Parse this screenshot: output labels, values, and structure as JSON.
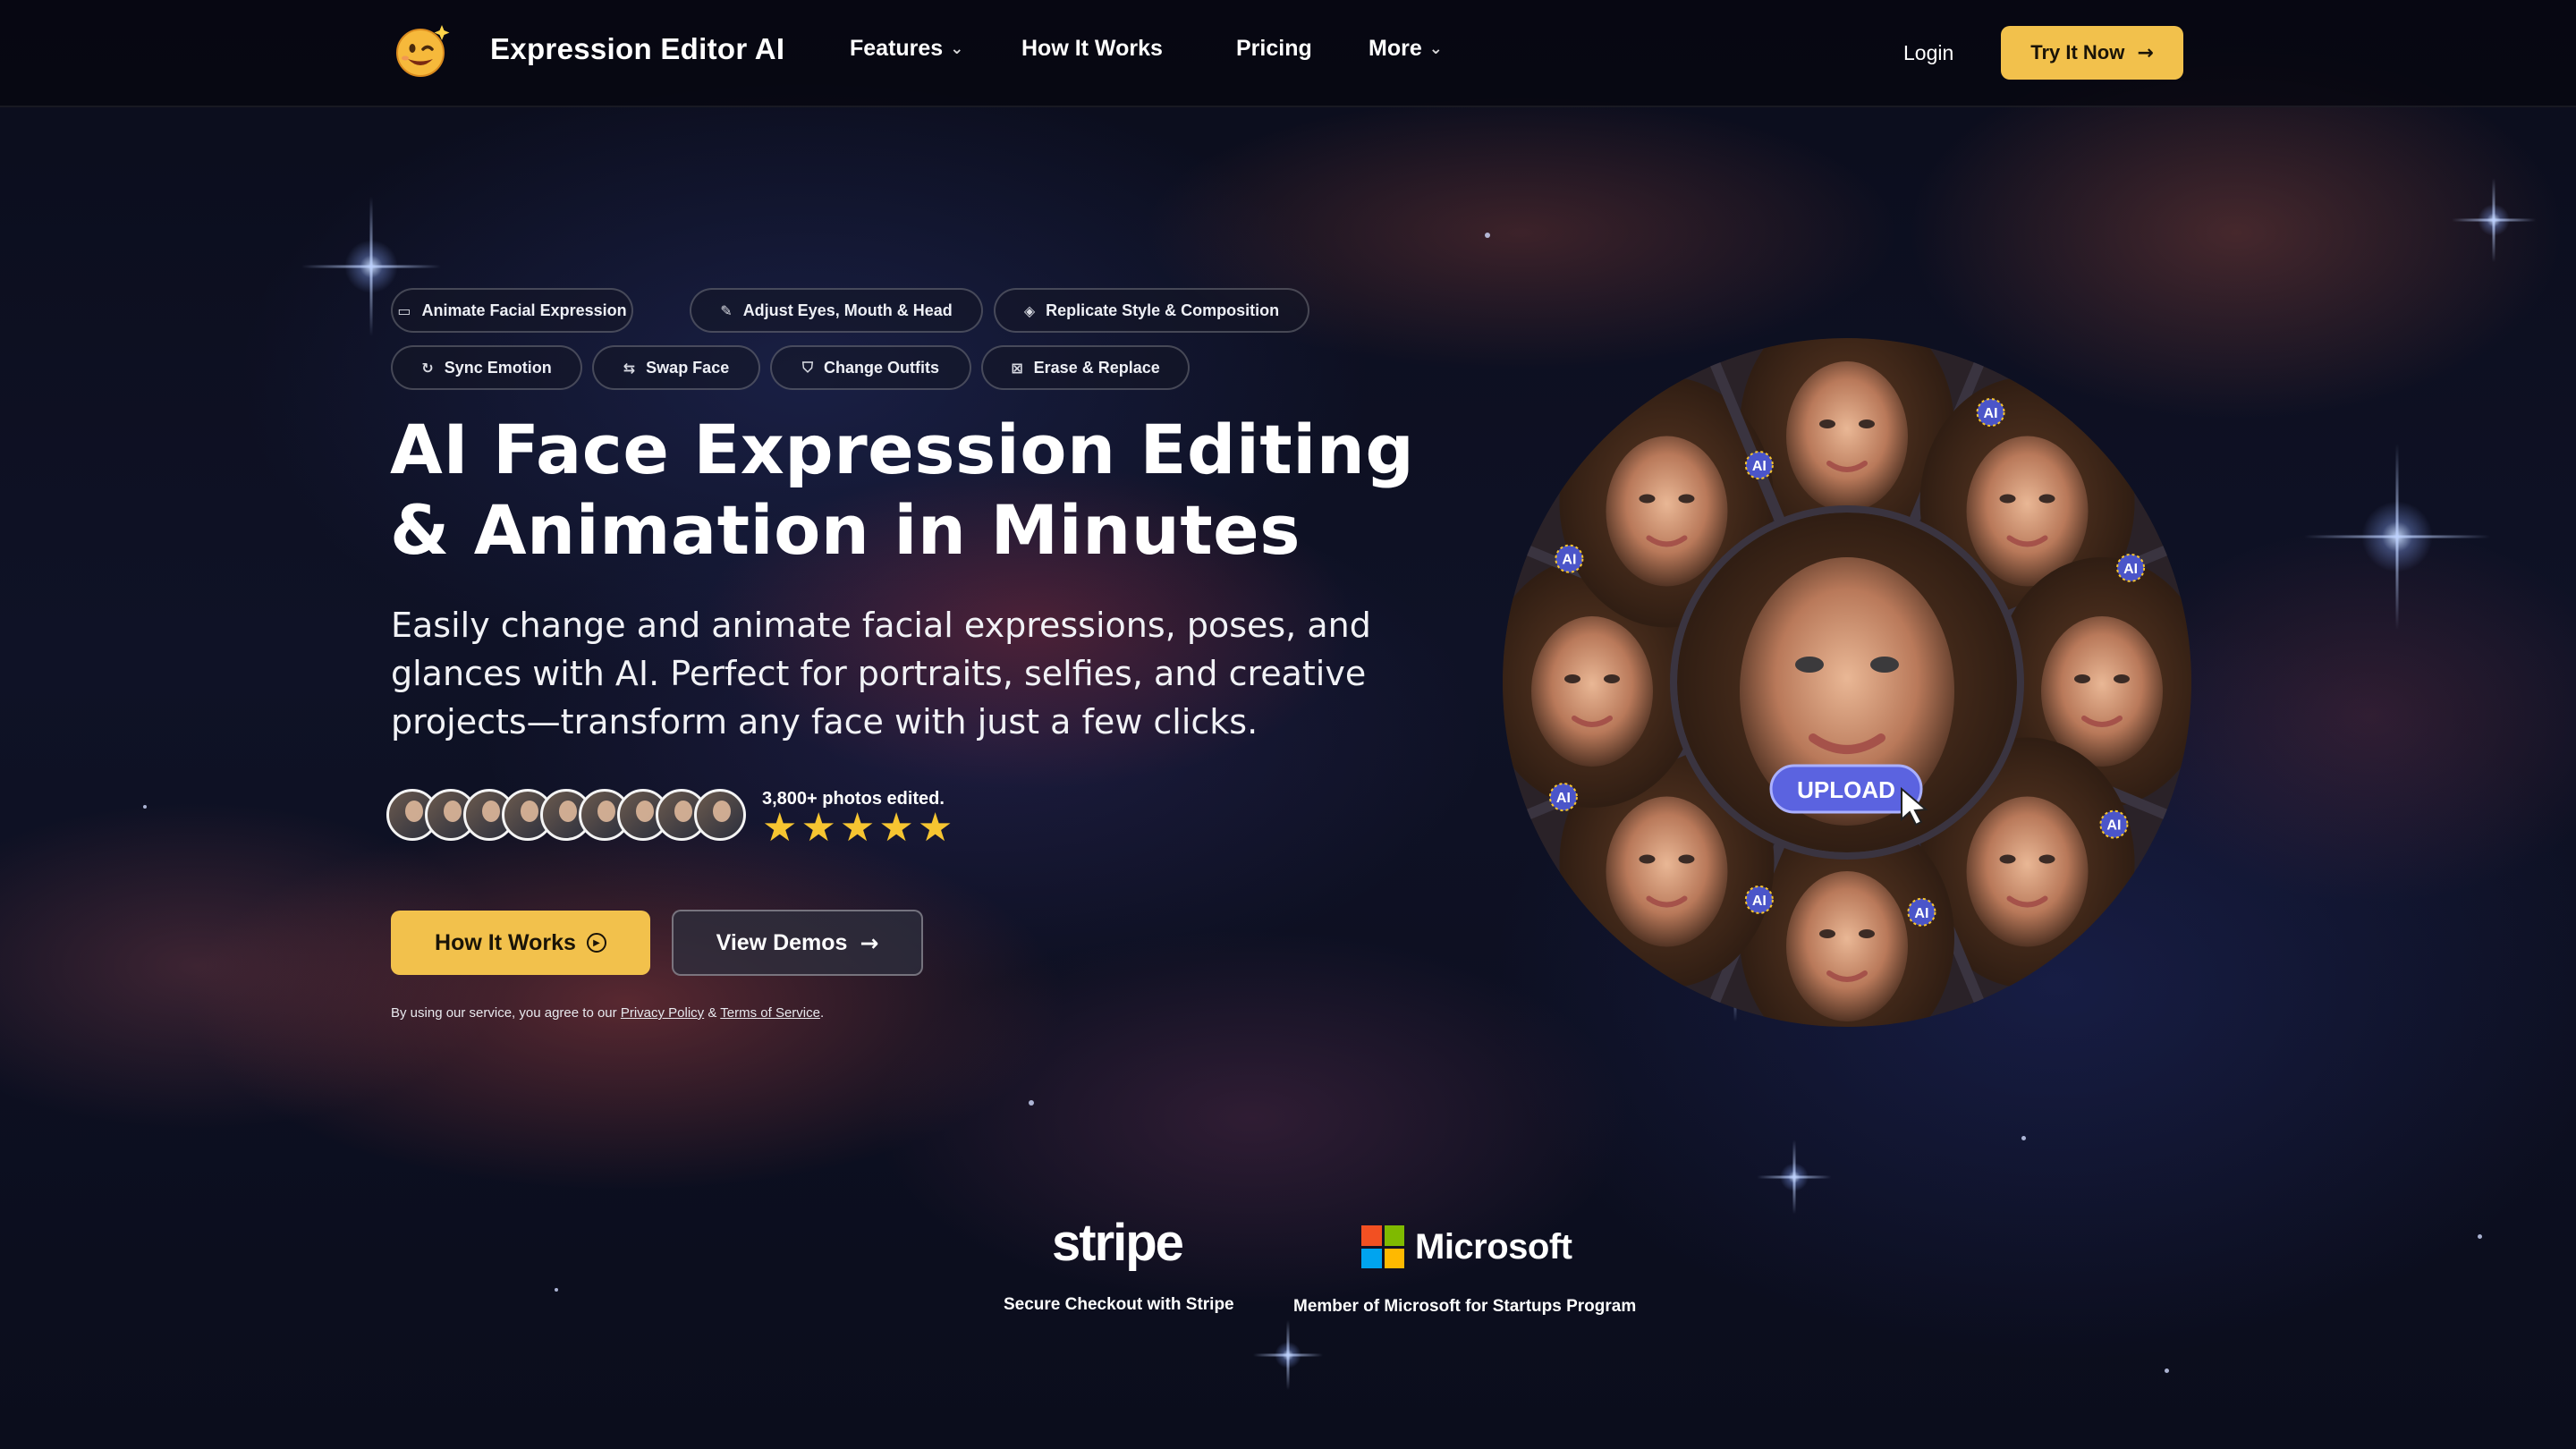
{
  "brand": {
    "name": "Expression Editor AI"
  },
  "nav": {
    "features": "Features",
    "how_it_works": "How It Works",
    "pricing": "Pricing",
    "more": "More",
    "login": "Login",
    "try_now": "Try It Now"
  },
  "chips": [
    {
      "label": "Animate Facial Expression",
      "icon": "video-icon"
    },
    {
      "label": "Adjust Eyes, Mouth & Head",
      "icon": "edit-icon"
    },
    {
      "label": "Replicate Style & Composition",
      "icon": "layers-icon"
    },
    {
      "label": "Sync Emotion",
      "icon": "refresh-icon"
    },
    {
      "label": "Swap Face",
      "icon": "swap-icon"
    },
    {
      "label": "Change Outfits",
      "icon": "shirt-icon"
    },
    {
      "label": "Erase & Replace",
      "icon": "eraser-icon"
    }
  ],
  "hero": {
    "headline_line1": "AI Face Expression Editing",
    "headline_line2": "& Animation in Minutes",
    "subtitle": "Easily change and animate facial expressions, poses, and glances with AI. Perfect for portraits, selfies, and creative projects—transform any face with just a few clicks."
  },
  "social_proof": {
    "count_text": "3,800+ photos edited.",
    "rating": 5,
    "avatar_count": 9
  },
  "cta": {
    "primary": "How It Works",
    "secondary": "View Demos"
  },
  "legal": {
    "prefix": "By using our service, you agree to our",
    "privacy": "Privacy Policy",
    "amp": "&",
    "terms": "Terms of Service",
    "suffix": "."
  },
  "wheel": {
    "upload_label": "UPLOAD",
    "badge_label": "AI"
  },
  "trust": {
    "stripe_logo": "stripe",
    "stripe_caption": "Secure Checkout with Stripe",
    "microsoft_logo": "Microsoft",
    "microsoft_caption": "Member of Microsoft for Startups Program"
  },
  "colors": {
    "accent": "#f2c14c",
    "upload_button": "#5b63e0",
    "star": "#f6c531",
    "background": "#0b0d1c"
  }
}
